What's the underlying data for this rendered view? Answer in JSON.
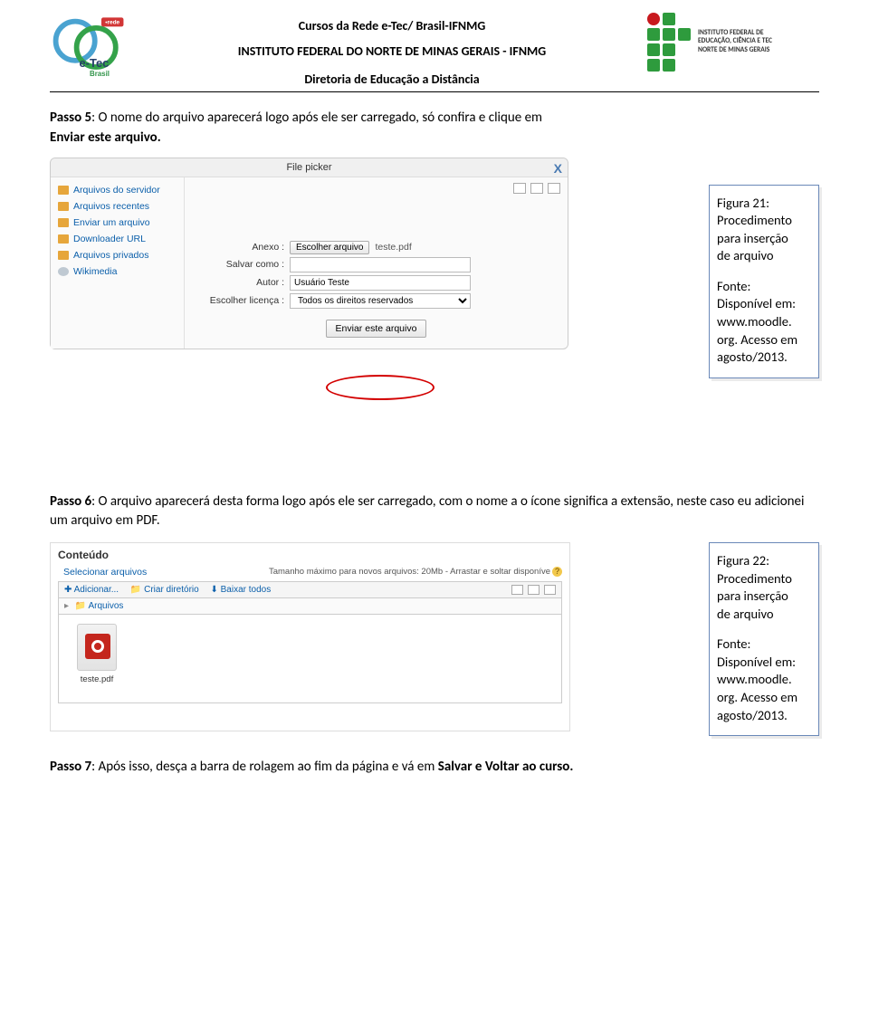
{
  "header": {
    "line1": "Cursos da Rede e-Tec/ Brasil-IFNMG",
    "line2": "INSTITUTO FEDERAL DO NORTE DE MINAS GERAIS - IFNMG",
    "line3": "Diretoria de Educação a Distância",
    "right_logo_text": "INSTITUTO FEDERAL DE\nEDUCAÇÃO, CIÊNCIA E TEC\nNORTE DE MINAS GERAIS"
  },
  "passo5": {
    "label": "Passo 5",
    "text": ": O nome do arquivo aparecerá logo após ele ser carregado, só confira e clique em ",
    "bold_tail": "Enviar este arquivo."
  },
  "filepicker": {
    "title": "File picker",
    "close": "X",
    "sidebar": [
      "Arquivos do servidor",
      "Arquivos recentes",
      "Enviar um arquivo",
      "Downloader URL",
      "Arquivos privados",
      "Wikimedia"
    ],
    "form": {
      "anexo_label": "Anexo :",
      "choose_btn": "Escolher arquivo",
      "filename": "teste.pdf",
      "salvar_label": "Salvar como :",
      "autor_label": "Autor :",
      "autor_value": "Usuário Teste",
      "licenca_label": "Escolher licença :",
      "licenca_value": "Todos os direitos reservados",
      "submit": "Enviar este arquivo"
    }
  },
  "caption1": {
    "title": "Figura 21:",
    "l1": "Procedimento",
    "l2": "para inserção",
    "l3": "de arquivo",
    "src1": "Fonte:",
    "src2": "Disponível em:",
    "src3": "www.moodle.",
    "src4": "org. Acesso em",
    "src5": "agosto/2013."
  },
  "passo6": {
    "label": "Passo 6",
    "text": ": O arquivo aparecerá desta forma logo após ele ser carregado, com o nome a o ícone significa a extensão, neste caso eu adicionei um arquivo em PDF."
  },
  "shot2": {
    "section": "Conteúdo",
    "select_label": "Selecionar arquivos",
    "max_note": "Tamanho máximo para novos arquivos: 20Mb - Arrastar e soltar disponíve",
    "tb_add": "Adicionar...",
    "tb_mkdir": "Criar diretório",
    "tb_download": "Baixar todos",
    "crumb": "Arquivos",
    "file_name": "teste.pdf"
  },
  "caption2": {
    "title": "Figura 22:",
    "l1": "Procedimento",
    "l2": "para inserção",
    "l3": "de arquivo",
    "src1": "Fonte:",
    "src2": "Disponível em:",
    "src3": "www.moodle.",
    "src4": "org. Acesso em",
    "src5": "agosto/2013."
  },
  "passo7": {
    "label": "Passo 7",
    "text": ": Após isso, desça a barra de rolagem ao fim da página e vá em ",
    "bold_tail": "Salvar e Voltar ao curso."
  }
}
